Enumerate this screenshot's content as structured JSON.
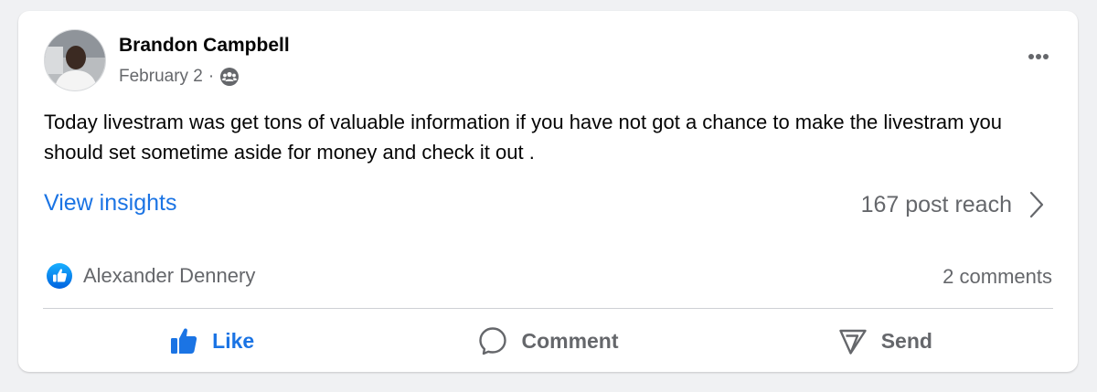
{
  "post": {
    "author": "Brandon Campbell",
    "date": "February 2",
    "separator": "·",
    "audience_icon": "friends-icon",
    "text": "Today livestram was get tons of valuable information if you have not got a chance to make the livestram you should set sometime aside for money and check it out .",
    "more_icon": "more-options-icon"
  },
  "insights": {
    "link_label": "View insights",
    "reach_label": "167 post reach",
    "reach_icon": "chevron-right-icon"
  },
  "engagement": {
    "reactor_name": "Alexander Dennery",
    "reaction_icon": "like-reaction-icon",
    "comments_label": "2 comments"
  },
  "actions": {
    "like_label": "Like",
    "comment_label": "Comment",
    "send_label": "Send"
  },
  "colors": {
    "accent": "#1b74e4",
    "secondary_text": "#65676b",
    "background": "#f0f1f3"
  }
}
